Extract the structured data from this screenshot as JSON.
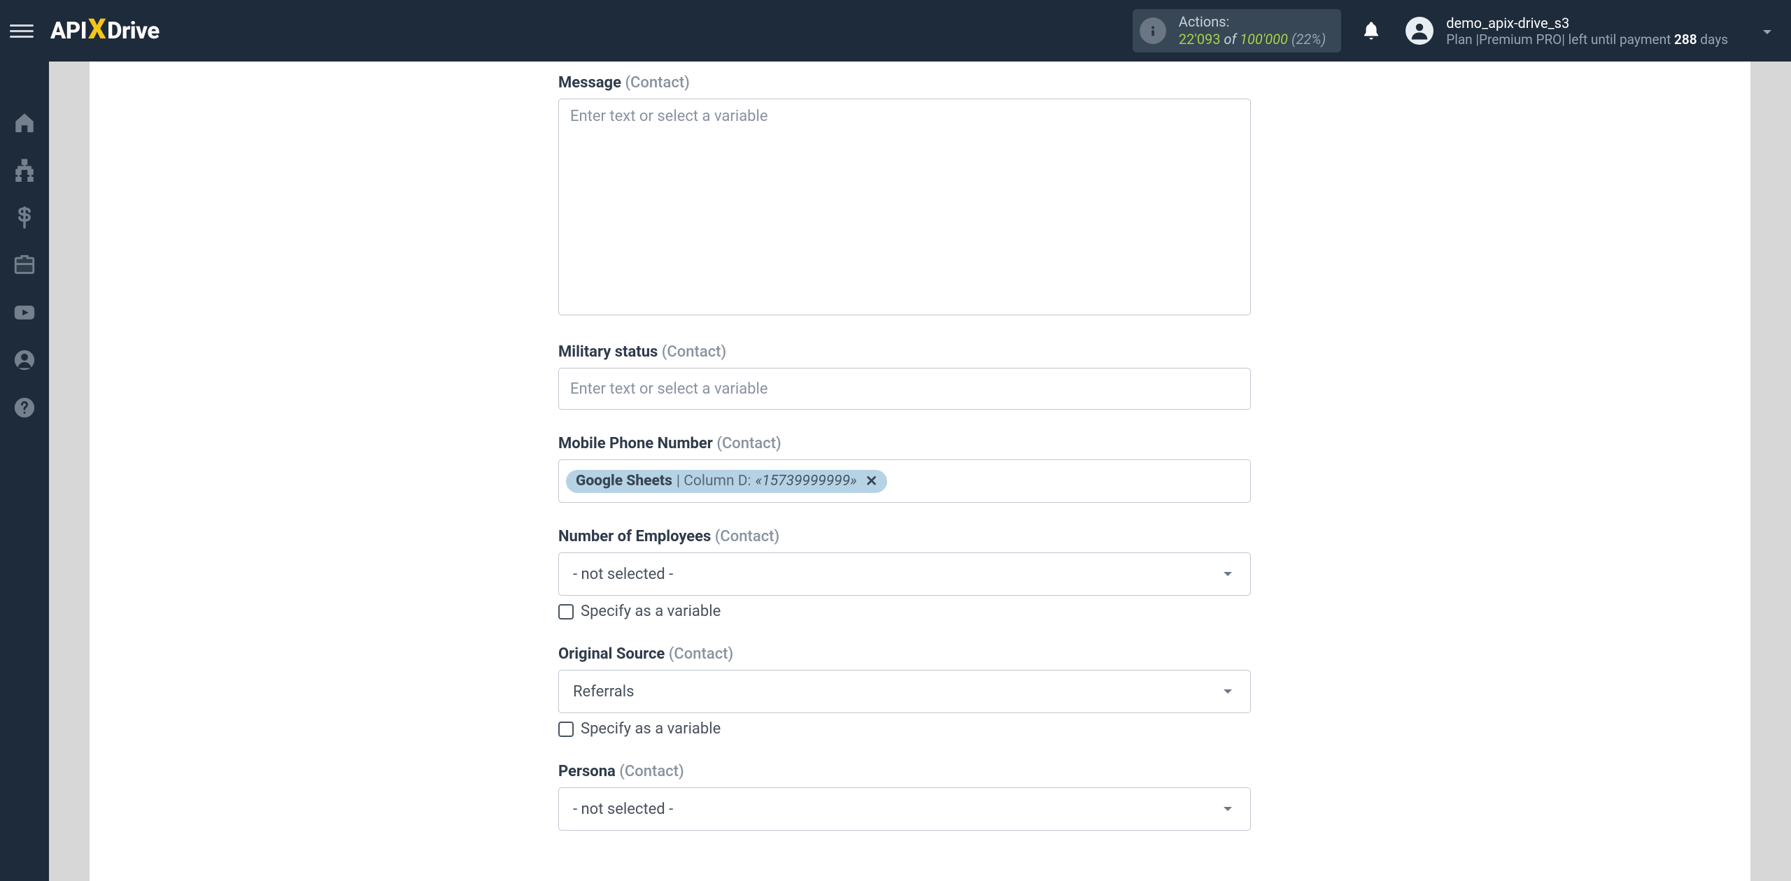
{
  "header": {
    "logo_left": "API",
    "logo_x": "X",
    "logo_right": "Drive",
    "actions_label": "Actions:",
    "actions_current": "22'093",
    "actions_of": " of ",
    "actions_total": "100'000",
    "actions_pct": " (22%)",
    "user_name": "demo_apix-drive_s3",
    "plan_prefix": "Plan |",
    "plan_name": "Premium PRO",
    "plan_mid": "| left until payment ",
    "plan_days": "288",
    "plan_suffix": " days"
  },
  "form": {
    "placeholder": "Enter text or select a variable",
    "contact": "(Contact)",
    "specify_var": "Specify as a variable",
    "not_selected": "- not selected -",
    "fields": {
      "message": {
        "label": "Message"
      },
      "military": {
        "label": "Military status"
      },
      "mobile": {
        "label": "Mobile Phone Number",
        "token_src": "Google Sheets",
        "token_sep": "| Column D:",
        "token_val": "«15739999999»"
      },
      "employees": {
        "label": "Number of Employees"
      },
      "origsource": {
        "label": "Original Source",
        "value": "Referrals"
      },
      "persona": {
        "label": "Persona"
      }
    }
  }
}
